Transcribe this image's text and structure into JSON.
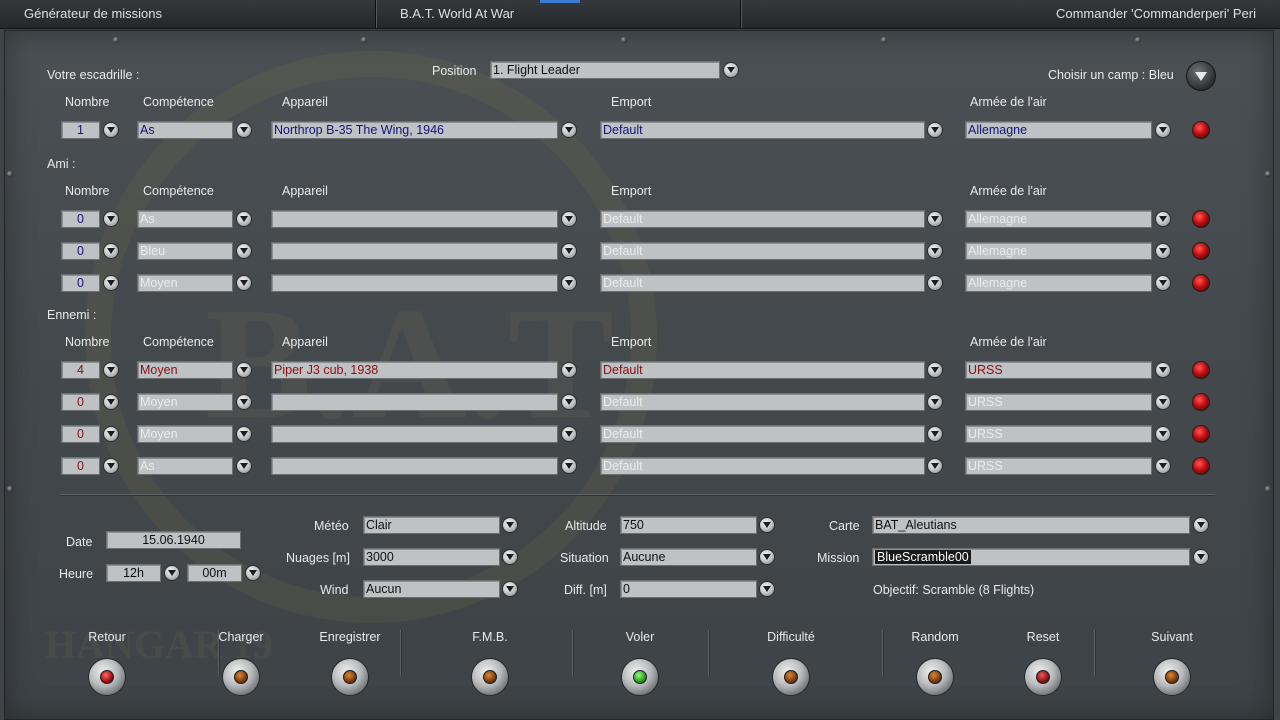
{
  "topbar": {
    "left": "Générateur de missions",
    "center": "B.A.T. World At War",
    "right": "Commander 'Commanderperi' Peri"
  },
  "squad": {
    "label": "Votre escadrille :",
    "position_label": "Position",
    "position_value": "1. Flight Leader",
    "camp_label": "Choisir un camp : Bleu"
  },
  "headers": {
    "nombre": "Nombre",
    "competence": "Compétence",
    "appareil": "Appareil",
    "emport": "Emport",
    "armee": "Armée de l'air"
  },
  "squad_row": {
    "nombre": "1",
    "competence": "As",
    "appareil": "Northrop B-35 The Wing, 1946",
    "emport": "Default",
    "armee": "Allemagne"
  },
  "friend": {
    "label": "Ami :",
    "rows": [
      {
        "nombre": "0",
        "competence": "As",
        "appareil": "",
        "emport": "Default",
        "armee": "Allemagne"
      },
      {
        "nombre": "0",
        "competence": "Bleu",
        "appareil": "",
        "emport": "Default",
        "armee": "Allemagne"
      },
      {
        "nombre": "0",
        "competence": "Moyen",
        "appareil": "",
        "emport": "Default",
        "armee": "Allemagne"
      }
    ]
  },
  "enemy": {
    "label": "Ennemi :",
    "rows": [
      {
        "nombre": "4",
        "competence": "Moyen",
        "appareil": "Piper J3 cub, 1938",
        "emport": "Default",
        "armee": "URSS"
      },
      {
        "nombre": "0",
        "competence": "Moyen",
        "appareil": "",
        "emport": "Default",
        "armee": "URSS"
      },
      {
        "nombre": "0",
        "competence": "Moyen",
        "appareil": "",
        "emport": "Default",
        "armee": "URSS"
      },
      {
        "nombre": "0",
        "competence": "As",
        "appareil": "",
        "emport": "Default",
        "armee": "URSS"
      }
    ]
  },
  "settings": {
    "date_label": "Date",
    "date_value": "15.06.1940",
    "heure_label": "Heure",
    "hour": "12h",
    "minute": "00m",
    "meteo_label": "Météo",
    "meteo": "Clair",
    "nuages_label": "Nuages [m]",
    "nuages": "3000",
    "wind_label": "Wind",
    "wind": "Aucun",
    "altitude_label": "Altitude",
    "altitude": "750",
    "situation_label": "Situation",
    "situation": "Aucune",
    "diff_label": "Diff. [m]",
    "diff": "0",
    "carte_label": "Carte",
    "carte": "BAT_Aleutians",
    "mission_label": "Mission",
    "mission": "BlueScramble00",
    "objectif": "Objectif: Scramble (8 Flights)"
  },
  "footer": {
    "buttons": [
      {
        "label": "Retour",
        "lamp": "red"
      },
      {
        "label": "Charger",
        "lamp": "amber"
      },
      {
        "label": "Enregistrer",
        "lamp": "amber"
      },
      {
        "label": "F.M.B.",
        "lamp": "amber"
      },
      {
        "label": "Voler",
        "lamp": "green"
      },
      {
        "label": "Difficulté",
        "lamp": "amber"
      },
      {
        "label": "Random",
        "lamp": "amber"
      },
      {
        "label": "Reset",
        "lamp": "dred"
      },
      {
        "label": "Suivant",
        "lamp": "amber"
      }
    ]
  },
  "watermark": {
    "bat": "B.A.T",
    "hangar": "HANGAR 19"
  }
}
